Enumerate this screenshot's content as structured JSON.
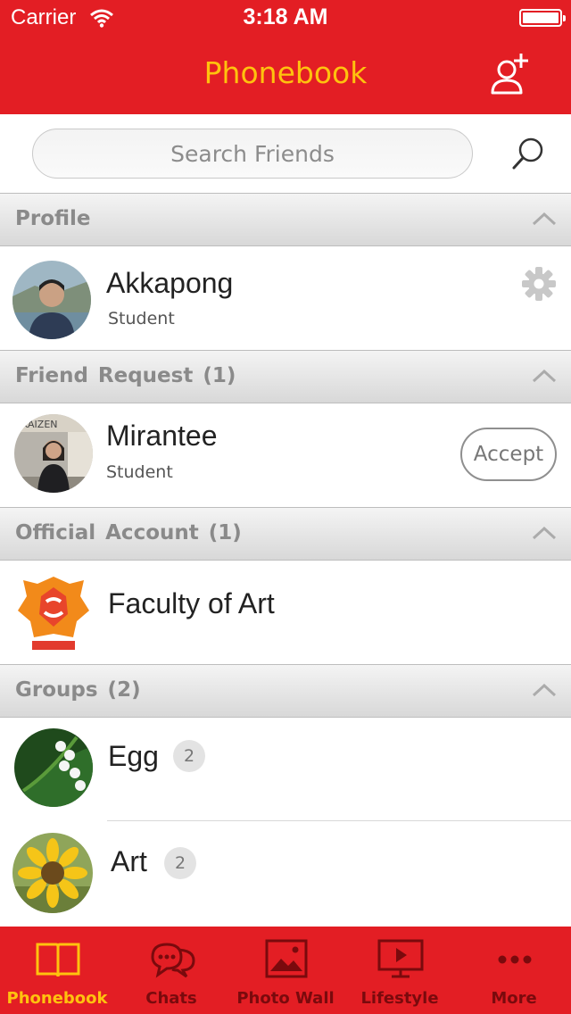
{
  "status_bar": {
    "carrier": "Carrier",
    "time": "3:18 AM"
  },
  "header": {
    "title": "Phonebook",
    "add_friend_icon": "add-friend-icon"
  },
  "search": {
    "placeholder": "Search Friends",
    "value": ""
  },
  "sections": {
    "profile": {
      "title": "Profile"
    },
    "friend_request": {
      "title": "Friend Request (1)"
    },
    "official_account": {
      "title": "Official Account (1)"
    },
    "groups": {
      "title": "Groups (2)"
    }
  },
  "profile": {
    "name": "Akkapong",
    "subtitle": "Student"
  },
  "friend_request": {
    "name": "Mirantee",
    "subtitle": "Student",
    "accept_label": "Accept"
  },
  "official_account": {
    "name": "Faculty of Art"
  },
  "groups": [
    {
      "name": "Egg",
      "count": "2"
    },
    {
      "name": "Art",
      "count": "2"
    }
  ],
  "tabs": [
    {
      "label": "Phonebook",
      "icon": "book-icon",
      "active": true
    },
    {
      "label": "Chats",
      "icon": "chat-bubbles-icon",
      "active": false
    },
    {
      "label": "Photo Wall",
      "icon": "image-icon",
      "active": false
    },
    {
      "label": "Lifestyle",
      "icon": "tv-play-icon",
      "active": false
    },
    {
      "label": "More",
      "icon": "more-dots-icon",
      "active": false
    }
  ],
  "colors": {
    "brand_red": "#e31e24",
    "title_yellow": "#ffc20e",
    "tab_inactive": "#7a0a0d"
  }
}
